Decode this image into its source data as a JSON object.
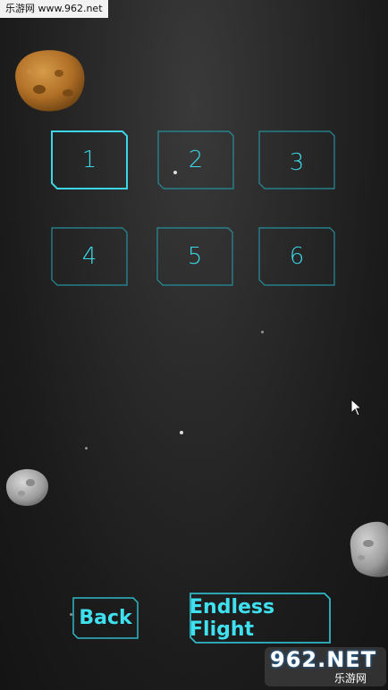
{
  "watermark_top": "乐游网 www.962.net",
  "levels": [
    {
      "label": "1",
      "selected": true
    },
    {
      "label": "2",
      "selected": false
    },
    {
      "label": "3",
      "selected": false
    },
    {
      "label": "4",
      "selected": false
    },
    {
      "label": "5",
      "selected": false
    },
    {
      "label": "6",
      "selected": false
    }
  ],
  "buttons": {
    "back": "Back",
    "endless": "Endless Flight"
  },
  "logo": {
    "main": "962.NET",
    "sub": "乐游网"
  },
  "colors": {
    "accent": "#3cd6e6",
    "border": "#2aa6b3"
  }
}
